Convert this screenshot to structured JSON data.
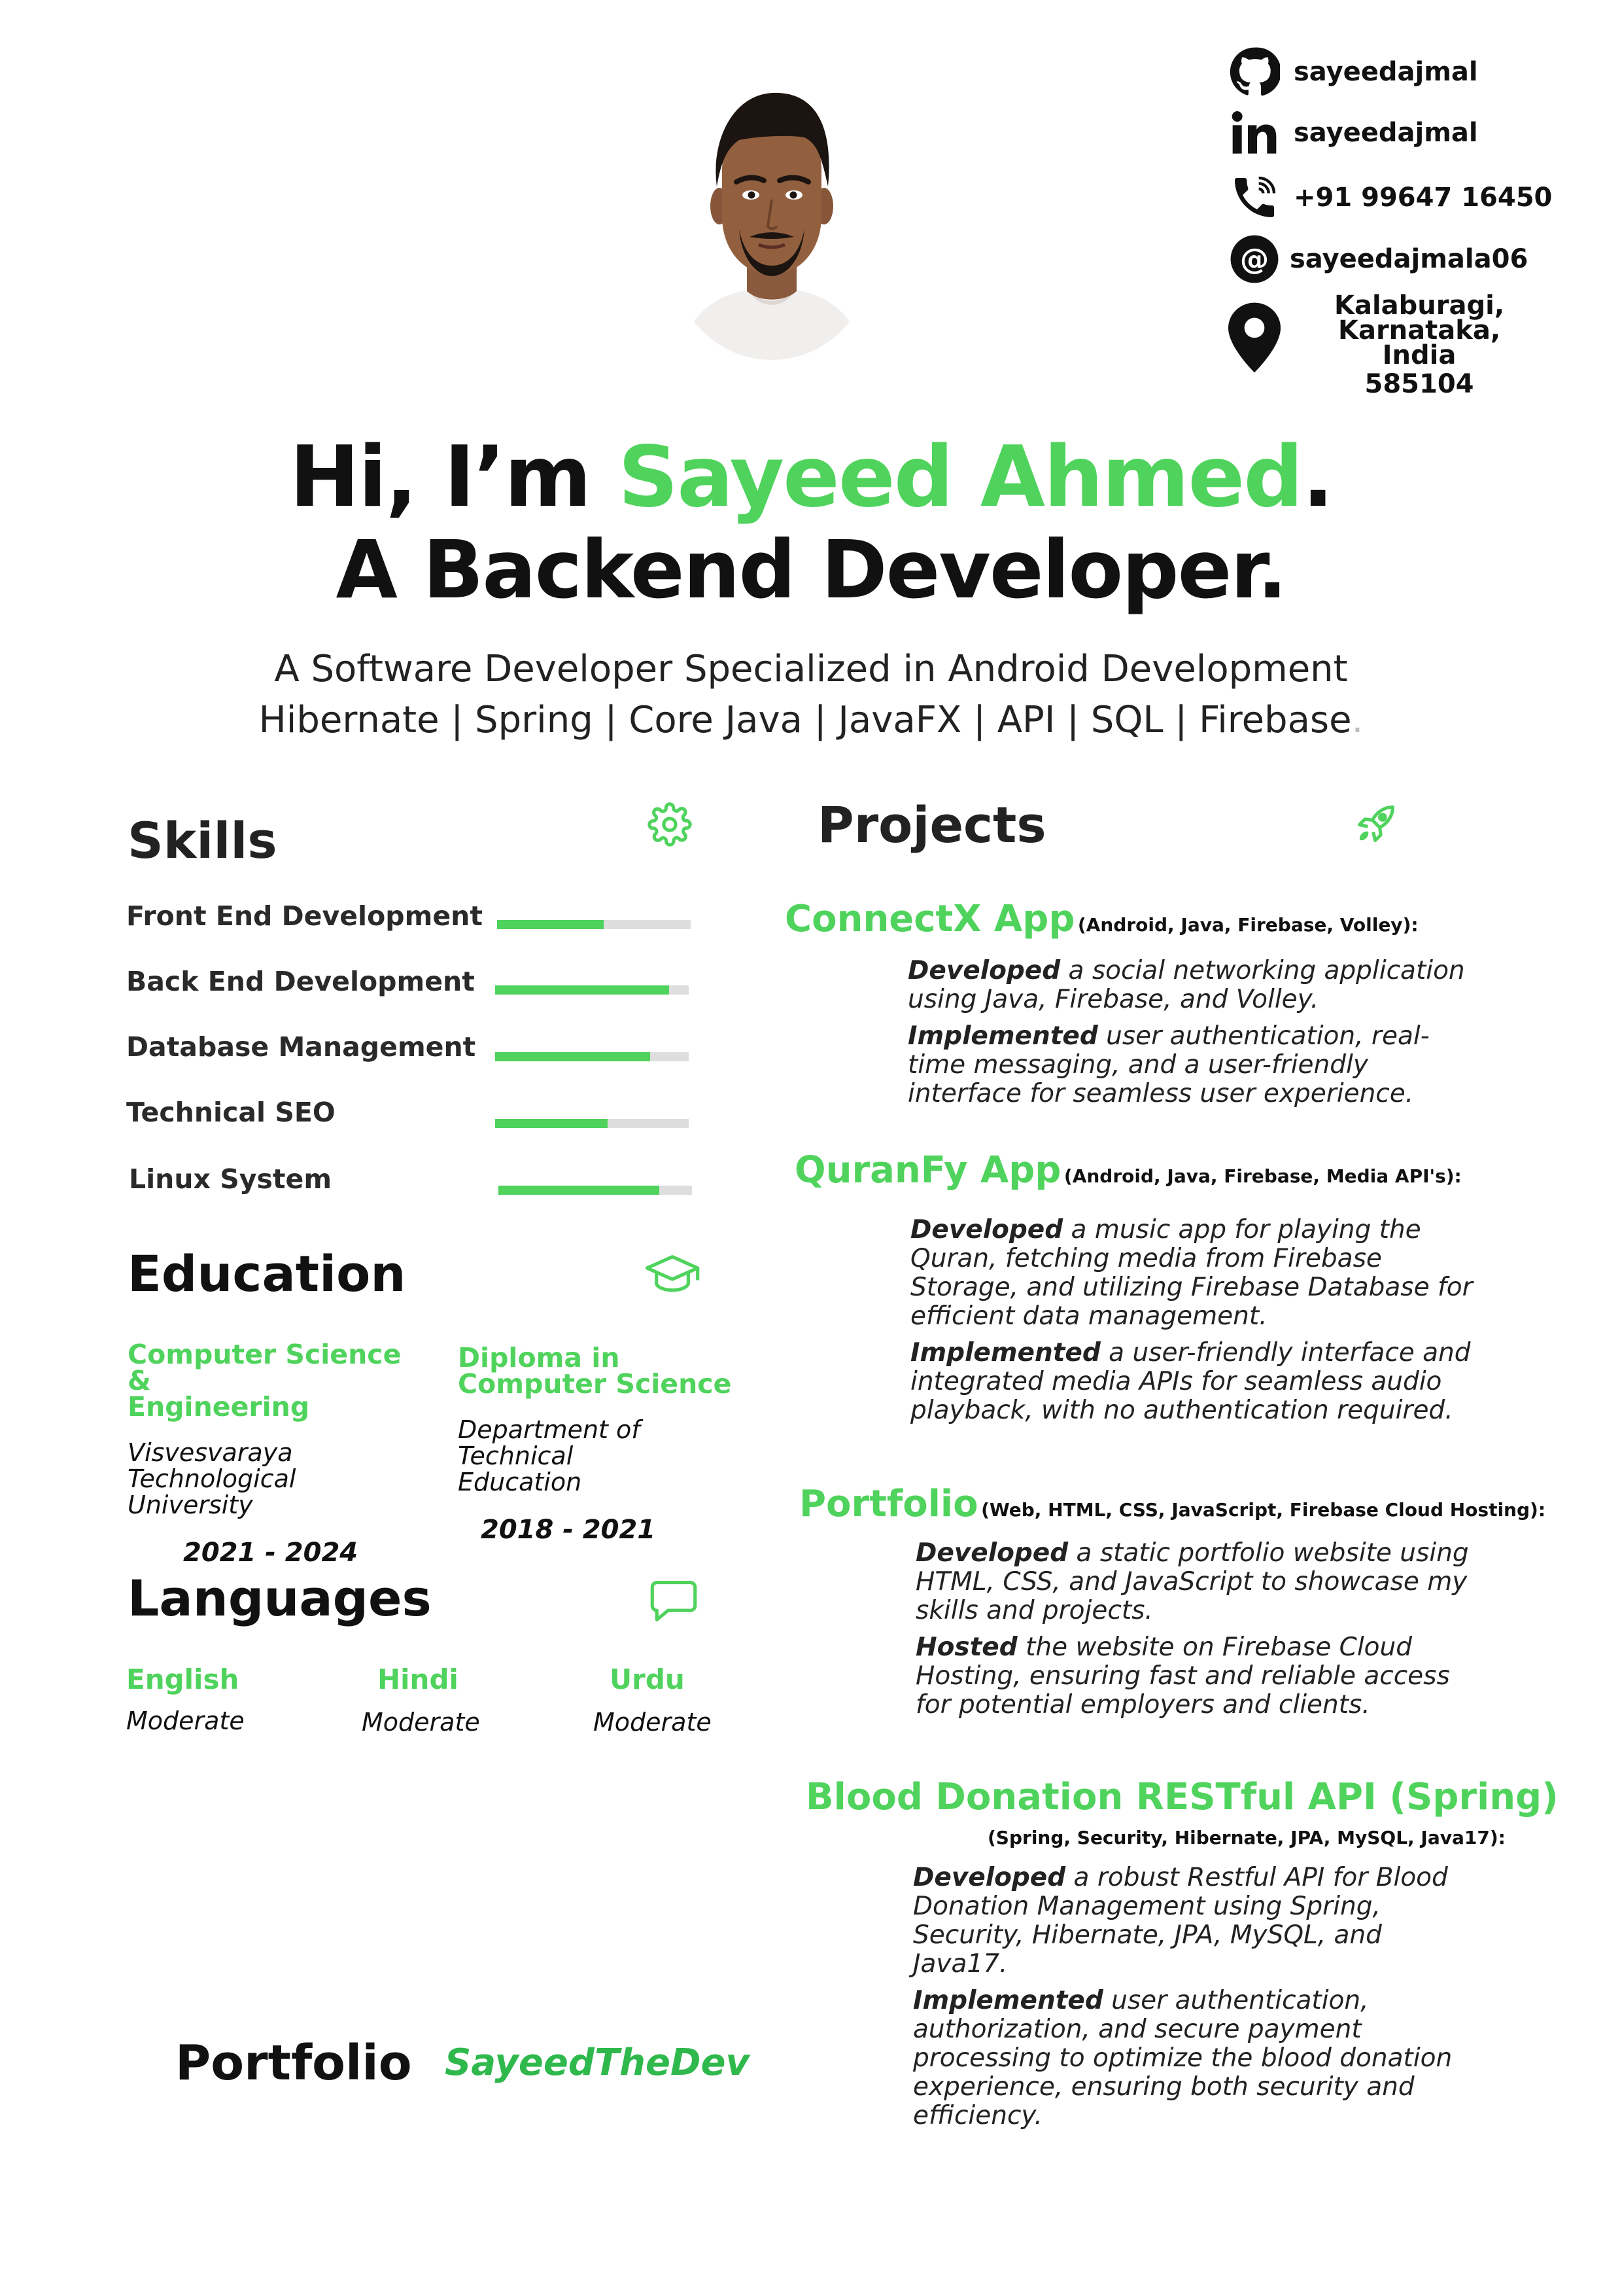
{
  "contact": {
    "github": "sayeedajmal",
    "linkedin": "sayeedajmal",
    "phone": "+91 99647 16450",
    "email": "sayeedajmala06",
    "address_lines": [
      "Kalaburagi,",
      "Karnataka,",
      "India",
      "585104"
    ]
  },
  "hero": {
    "greeting": "Hi, I’m ",
    "name": "Sayeed Ahmed",
    "name_end": ".",
    "role": "A Backend Developer.",
    "subtitle_line1": "A Software Developer Specialized in Android Development",
    "subtitle_line2": "Hibernate | Spring | Core Java | JavaFX | API | SQL | Firebase",
    "subtitle_line2_end": "."
  },
  "skills": {
    "title": "Skills",
    "icon": "gear-icon",
    "items": [
      {
        "label": "Front End Development",
        "level": 0.55
      },
      {
        "label": "Back End Development",
        "level": 0.9
      },
      {
        "label": "Database Management",
        "level": 0.8
      },
      {
        "label": "Technical SEO",
        "level": 0.58
      },
      {
        "label": "Linux System",
        "level": 0.83
      }
    ]
  },
  "education": {
    "title": "Education",
    "icon": "graduation-cap-icon",
    "entries": [
      {
        "degree_line1": "Computer Science &",
        "degree_line2": "Engineering",
        "inst_line1": "Visvesvaraya",
        "inst_line2": "Technological University",
        "years": "2021 - 2024"
      },
      {
        "degree_line1": "Diploma in",
        "degree_line2": "Computer Science",
        "inst_line1": "Department of Technical",
        "inst_line2": "Education",
        "years": "2018 - 2021"
      }
    ]
  },
  "languages": {
    "title": "Languages",
    "icon": "chat-bubble-icon",
    "items": [
      {
        "name": "English",
        "level": "Moderate"
      },
      {
        "name": "Hindi",
        "level": "Moderate"
      },
      {
        "name": "Urdu",
        "level": "Moderate"
      }
    ]
  },
  "projects": {
    "title": "Projects",
    "icon": "rocket-icon",
    "items": [
      {
        "name": "ConnectX App",
        "tech": "(Android, Java, Firebase, Volley):",
        "p1_bold": "Developed",
        "p1_text": " a social networking application using Java, Firebase, and Volley.",
        "p2_bold": "Implemented",
        "p2_text": " user authentication, real-time messaging, and a user-friendly interface for seamless user experience."
      },
      {
        "name": "QuranFy App",
        "tech": "(Android, Java, Firebase, Media API's):",
        "p1_bold": "Developed",
        "p1_text": " a music app for playing the Quran, fetching media from Firebase Storage, and utilizing Firebase Database for efficient data management.",
        "p2_bold": "Implemented",
        "p2_text": " a user-friendly interface and integrated media APIs for seamless audio playback, with no authentication required."
      },
      {
        "name": "Portfolio",
        "tech": "(Web, HTML, CSS, JavaScript, Firebase Cloud Hosting):",
        "p1_bold": "Developed",
        "p1_text": " a static portfolio website using HTML, CSS, and JavaScript to showcase my skills and projects.",
        "p2_bold": "Hosted",
        "p2_text": " the website on Firebase Cloud Hosting, ensuring fast and reliable access for potential employers and clients."
      },
      {
        "name": "Blood Donation RESTful API (Spring)",
        "tech": "(Spring, Security, Hibernate, JPA, MySQL, Java17):",
        "p1_bold": "Developed",
        "p1_text": " a robust Restful API for Blood Donation Management using Spring, Security, Hibernate, JPA, MySQL, and Java17.",
        "p2_bold": "Implemented",
        "p2_text": " user authentication, authorization, and secure payment processing to optimize the blood donation experience, ensuring both security and efficiency."
      }
    ]
  },
  "footer": {
    "label": "Portfolio",
    "handle": "SayeedTheDev"
  },
  "colors": {
    "accent": "#4fd35c",
    "text": "#111111",
    "bar_track": "#dedede"
  }
}
